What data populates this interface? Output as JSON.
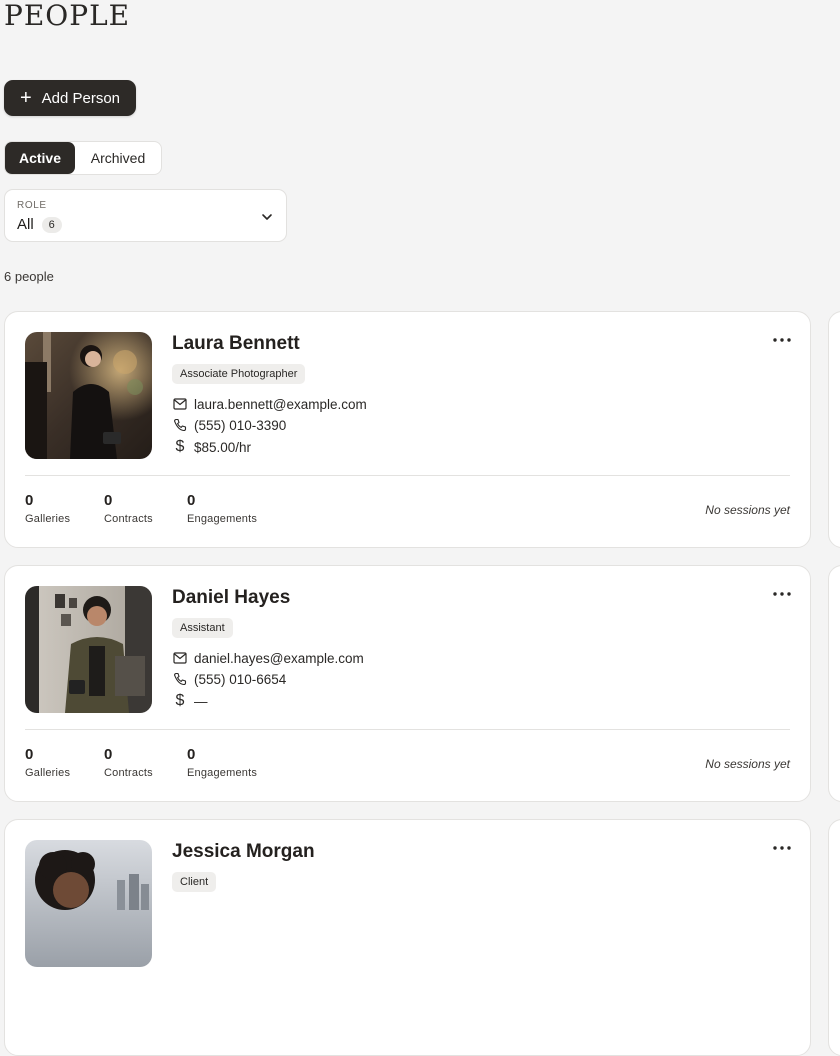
{
  "header": {
    "title": "PEOPLE",
    "add_button_label": "Add Person",
    "add_button_icon": "plus-icon"
  },
  "tabs": [
    {
      "label": "Active",
      "selected": true
    },
    {
      "label": "Archived",
      "selected": false
    }
  ],
  "filter": {
    "label": "ROLE",
    "value": "All",
    "count": "6"
  },
  "people_count": "6 people",
  "people": [
    {
      "name": "Laura Bennett",
      "role": "Associate Photographer",
      "email": "laura.bennett@example.com",
      "phone": "(555) 010-3390",
      "rate": "$85.00/hr",
      "stats": [
        {
          "value": "0",
          "label": "Galleries"
        },
        {
          "value": "0",
          "label": "Contracts"
        },
        {
          "value": "0",
          "label": "Engagements"
        }
      ],
      "sessions": "No sessions yet"
    },
    {
      "name": "Daniel Hayes",
      "role": "Assistant",
      "email": "daniel.hayes@example.com",
      "phone": "(555) 010-6654",
      "rate": "—",
      "stats": [
        {
          "value": "0",
          "label": "Galleries"
        },
        {
          "value": "0",
          "label": "Contracts"
        },
        {
          "value": "0",
          "label": "Engagements"
        }
      ],
      "sessions": "No sessions yet"
    },
    {
      "name": "Jessica Morgan",
      "role": "Client"
    }
  ],
  "colors": {
    "primary_dark": "#2d2a27",
    "background": "#f4f4f4",
    "card": "#ffffff",
    "badge_bg": "#efeeec"
  }
}
